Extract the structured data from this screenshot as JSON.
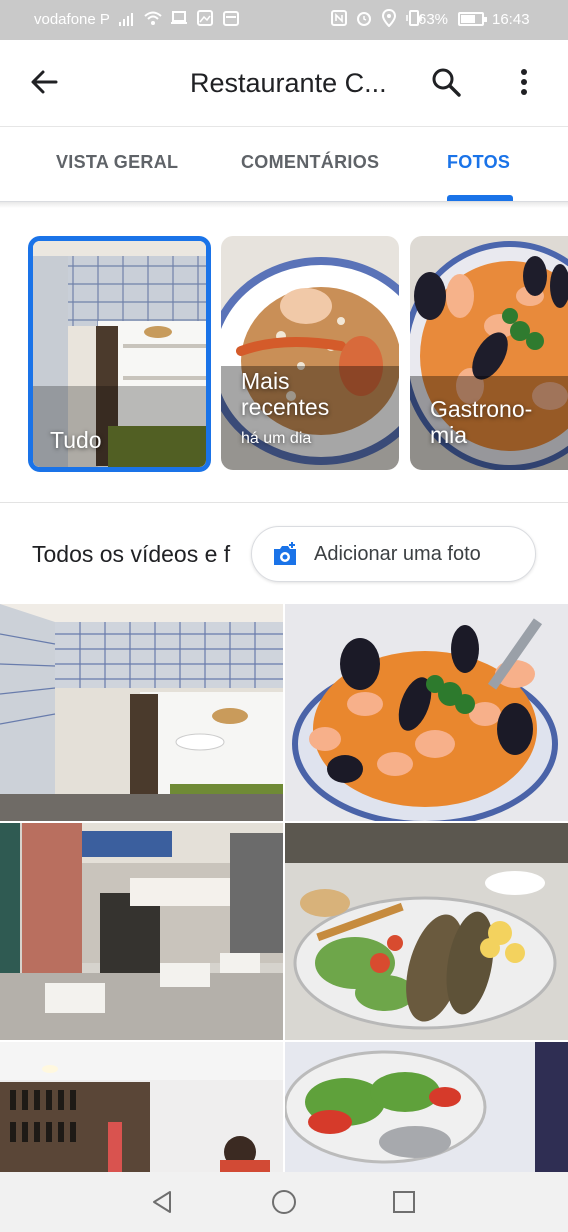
{
  "status_bar": {
    "carrier": "vodafone P",
    "battery": "63%",
    "time": "16:43"
  },
  "app_bar": {
    "title": "Restaurante C..."
  },
  "tabs": [
    {
      "label": "VISTA GERAL",
      "active": false
    },
    {
      "label": "COMENTÁRIOS",
      "active": false
    },
    {
      "label": "FOTOS",
      "active": true
    }
  ],
  "categories": [
    {
      "label": "Tudo",
      "sub": "",
      "selected": true
    },
    {
      "label": "Mais recentes",
      "sub": "há um dia",
      "selected": false
    },
    {
      "label": "Gastrono-mia",
      "sub": "",
      "selected": false
    }
  ],
  "section": {
    "title": "Todos os vídeos e f",
    "add_photo_label": "Adicionar uma foto"
  },
  "colors": {
    "accent": "#1a73e8",
    "status_bar": "#c9c9c9",
    "text_primary": "#202124",
    "text_secondary": "#5f6368"
  },
  "icons": {
    "back": "arrow-left-icon",
    "search": "search-icon",
    "more": "more-vert-icon",
    "add_photo": "add-photo-camera-icon",
    "nav_back": "triangle-back-icon",
    "nav_home": "circle-home-icon",
    "nav_recents": "square-recents-icon"
  }
}
